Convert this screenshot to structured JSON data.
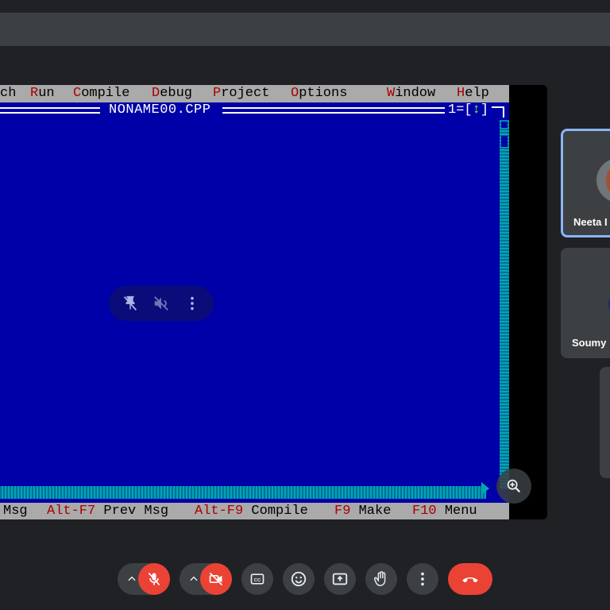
{
  "colors": {
    "meet_bg": "#202124",
    "tile_bg": "#3c4043",
    "active_border": "#8ab4f8",
    "danger": "#ea4335",
    "tc_blue": "#0000a8",
    "tc_gray": "#aaaaaa",
    "tc_hot": "#aa0000"
  },
  "turbo_c": {
    "menu": {
      "partial_first": "ch",
      "items": [
        {
          "hot": "R",
          "rest": "un"
        },
        {
          "hot": "C",
          "rest": "ompile"
        },
        {
          "hot": "D",
          "rest": "ebug"
        },
        {
          "hot": "P",
          "rest": "roject"
        },
        {
          "hot": "O",
          "rest": "ptions"
        },
        {
          "hot": "W",
          "rest": "indow"
        },
        {
          "hot": "H",
          "rest": "elp"
        }
      ]
    },
    "window_title": "NONAME00.CPP",
    "window_number": "1",
    "window_number_suffix_left": "=[",
    "window_resize_glyph": "↕",
    "window_number_suffix_right": "]",
    "status": [
      {
        "key": "",
        "label": "Msg"
      },
      {
        "key": "Alt-F7",
        "label": "Prev Msg"
      },
      {
        "key": "Alt-F9",
        "label": "Compile"
      },
      {
        "key": "F9",
        "label": "Make"
      },
      {
        "key": "F10",
        "label": "Menu"
      }
    ]
  },
  "presentation_overlay": {
    "icons": [
      "unpin-icon",
      "mute-audio-icon",
      "more-options-icon"
    ],
    "zoom_icon": "zoom-in-icon"
  },
  "participants": [
    {
      "name": "Neeta I",
      "active": true
    },
    {
      "name": "Soumy",
      "active": false
    }
  ],
  "controls": {
    "mic": {
      "icon": "mic-off-icon",
      "state": "off"
    },
    "camera": {
      "icon": "camera-off-icon",
      "state": "off"
    },
    "captions_icon": "closed-captions-icon",
    "emoji_icon": "emoji-icon",
    "present_icon": "present-screen-icon",
    "raise_hand_icon": "raise-hand-icon",
    "more_icon": "more-options-icon",
    "end_call_icon": "end-call-icon"
  }
}
